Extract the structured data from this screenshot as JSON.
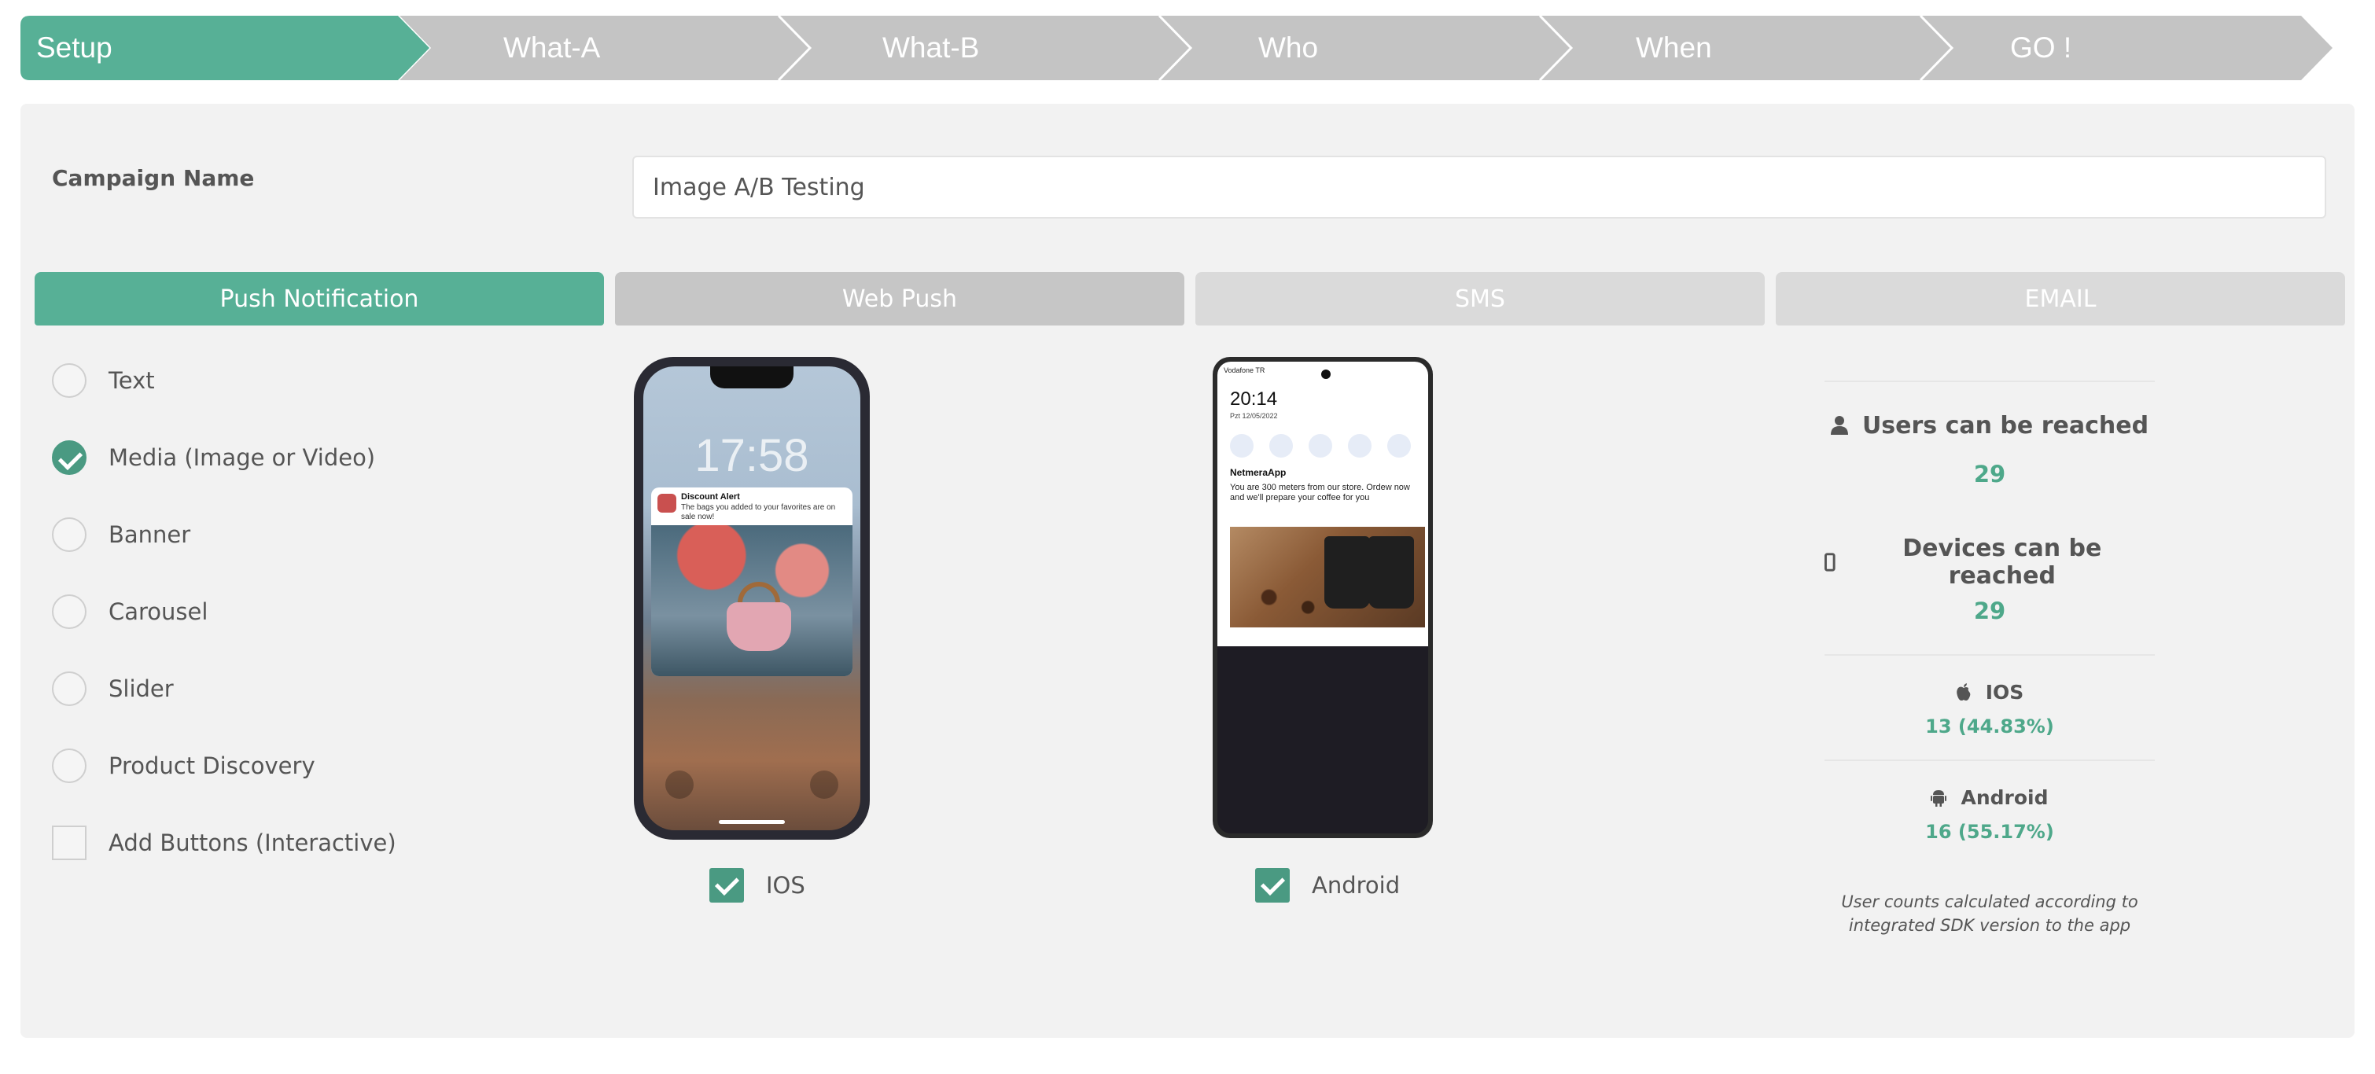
{
  "steps": [
    "Setup",
    "What-A",
    "What-B",
    "Who",
    "When",
    "GO !"
  ],
  "campaign": {
    "label": "Campaign Name",
    "value": "Image A/B Testing"
  },
  "tabs": [
    "Push Notification",
    "Web Push",
    "SMS",
    "EMAIL"
  ],
  "options": [
    {
      "label": "Text",
      "selected": false
    },
    {
      "label": "Media (Image or Video)",
      "selected": true
    },
    {
      "label": "Banner",
      "selected": false
    },
    {
      "label": "Carousel",
      "selected": false
    },
    {
      "label": "Slider",
      "selected": false
    },
    {
      "label": "Product Discovery",
      "selected": false
    },
    {
      "label": "Add Buttons (Interactive)",
      "selected": false
    }
  ],
  "preview_ios": {
    "time": "17:58",
    "notification_title": "Discount Alert",
    "notification_body": "The bags you added to your favorites are on sale now!"
  },
  "preview_android": {
    "carrier": "Vodafone TR",
    "time": "20:14",
    "date": "Pzt 12/05/2022",
    "app_name": "NetmeraApp",
    "message": "You are 300 meters from our store. Ordew now and we'll prepare your coffee for you"
  },
  "platforms": {
    "ios": {
      "label": "IOS",
      "checked": true
    },
    "android": {
      "label": "Android",
      "checked": true
    }
  },
  "reach": {
    "users_label": "Users can be reached",
    "users_value": "29",
    "devices_label": "Devices can be reached",
    "devices_value": "29",
    "ios_label": "IOS",
    "ios_value": "13 (44.83%)",
    "android_label": "Android",
    "android_value": "16 (55.17%)",
    "note_line1": "User counts calculated according to",
    "note_line2": "integrated SDK version to the app"
  },
  "colors": {
    "accent": "#57b096",
    "step_inactive": "#c4c4c4",
    "value_green": "#4ea88a"
  }
}
